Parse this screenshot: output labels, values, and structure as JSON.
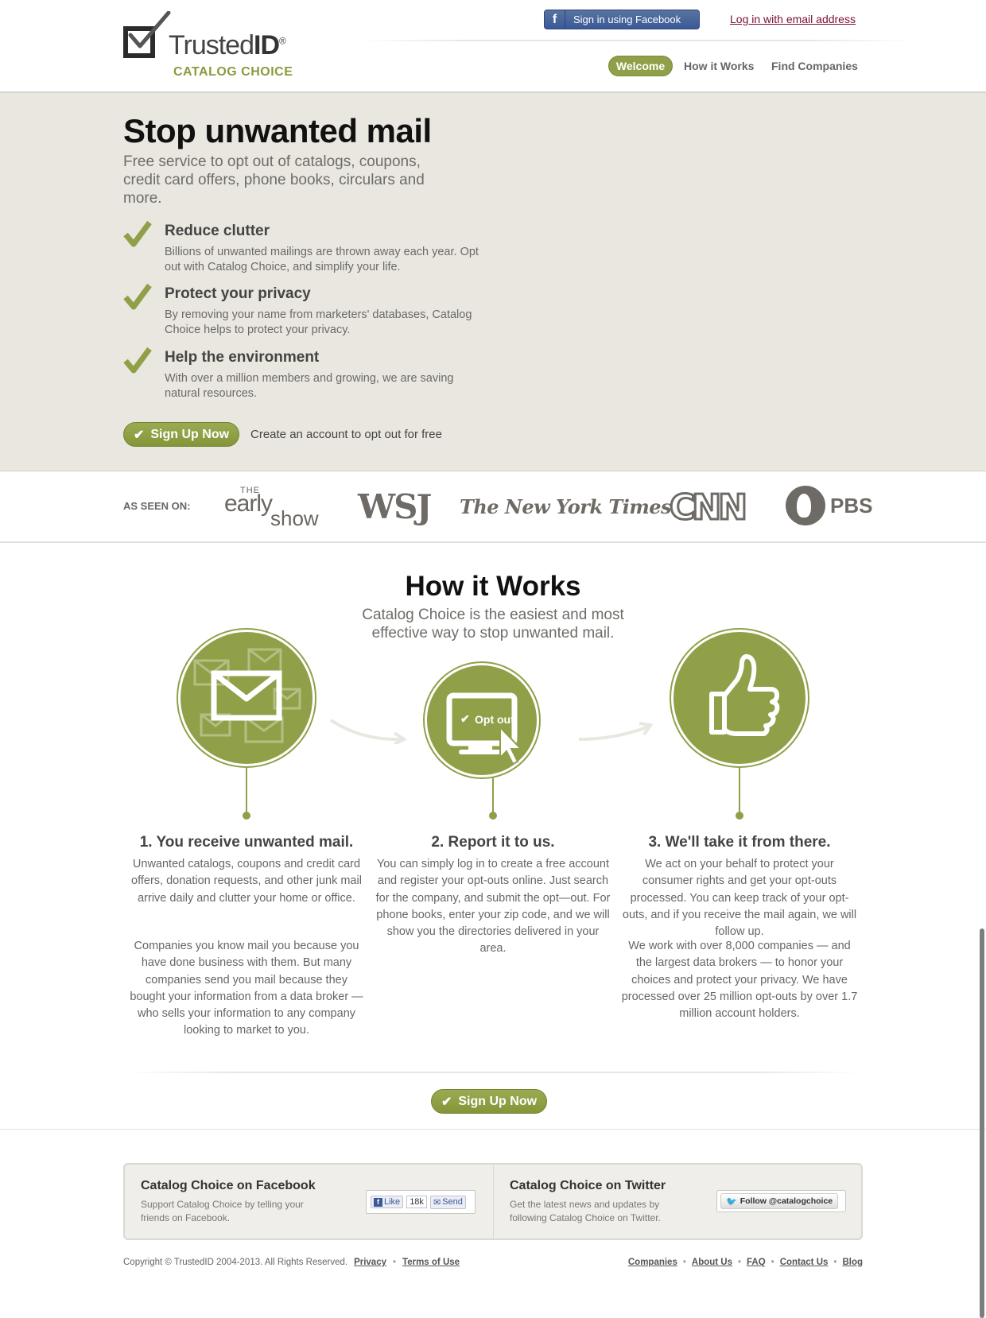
{
  "header": {
    "logo_word": "Trusted",
    "logo_word_bold": "ID",
    "logo_reg": "®",
    "logo_sub": "CATALOG CHOICE",
    "fb_signin": "Sign in using Facebook",
    "email_login": "Log in with email address",
    "nav": {
      "welcome": "Welcome",
      "how": "How it Works",
      "find": "Find Companies"
    }
  },
  "hero": {
    "title": "Stop unwanted mail",
    "subtitle": "Free service to opt out of catalogs, coupons, credit card offers, phone books, circulars and more.",
    "features": [
      {
        "title": "Reduce clutter",
        "text": "Billions of unwanted mailings are thrown away each year. Opt out with Catalog Choice, and simplify your life."
      },
      {
        "title": "Protect your privacy",
        "text": "By removing your name from marketers' databases, Catalog Choice helps to protect your privacy."
      },
      {
        "title": "Help the environment",
        "text": "With over a million members and growing, we are saving natural resources."
      }
    ],
    "signup": "Sign Up Now",
    "cta_note": "Create an account to opt out for free"
  },
  "seen": {
    "label": "AS SEEN ON:",
    "early_1": "THE",
    "early_2": "early",
    "early_3": "show",
    "wsj": "WSJ",
    "nyt": "The New York Times",
    "cnn": "CNN",
    "pbs": "PBS"
  },
  "how": {
    "title": "How it Works",
    "subtitle": "Catalog Choice is the easiest and most effective way to stop unwanted mail.",
    "optout_label": "Opt out",
    "steps": [
      {
        "title": "1. You receive unwanted mail.",
        "p1": "Unwanted catalogs, coupons and credit card offers, donation requests, and other junk mail arrive daily and clutter your home or office.",
        "p2": "Companies you know mail you because you have done business with them. But many companies send you mail because they bought your information from a data broker — who sells your information to any company looking to market to you."
      },
      {
        "title": "2. Report it to us.",
        "p1": "You can simply log in to create a free account and register your opt-outs online. Just search for the company, and submit the opt—out. For phone books, enter your zip code, and we will show you the directories delivered in your area."
      },
      {
        "title": "3. We'll take it from there.",
        "p1": "We act on your behalf to protect your consumer rights and get your opt-outs processed. You can keep track of your opt-outs, and if you receive the mail again, we will follow up.",
        "p2": "We work with over 8,000 companies — and the largest data brokers — to honor your choices and protect your privacy. We have processed over 25 million opt-outs by over 1.7 million account holders."
      }
    ],
    "signup": "Sign Up Now"
  },
  "social": {
    "facebook": {
      "title": "Catalog Choice on Facebook",
      "text": "Support Catalog Choice by telling your friends on Facebook.",
      "like": "Like",
      "count": "18k",
      "send": "Send"
    },
    "twitter": {
      "title": "Catalog Choice on Twitter",
      "text": "Get the latest news and updates by following Catalog Choice on Twitter.",
      "follow": "Follow @catalogchoice"
    }
  },
  "footer": {
    "copyright": "Copyright © TrustedID 2004-2013. All Rights Reserved.",
    "privacy": "Privacy",
    "terms": "Terms of Use",
    "sep": "•",
    "links": [
      "Companies",
      "About Us",
      "FAQ",
      "Contact Us",
      "Blog"
    ]
  },
  "colors": {
    "accent": "#8fa048",
    "hero_bg": "#e9e7df",
    "facebook": "#3b5998",
    "login_link": "#7a1030"
  }
}
